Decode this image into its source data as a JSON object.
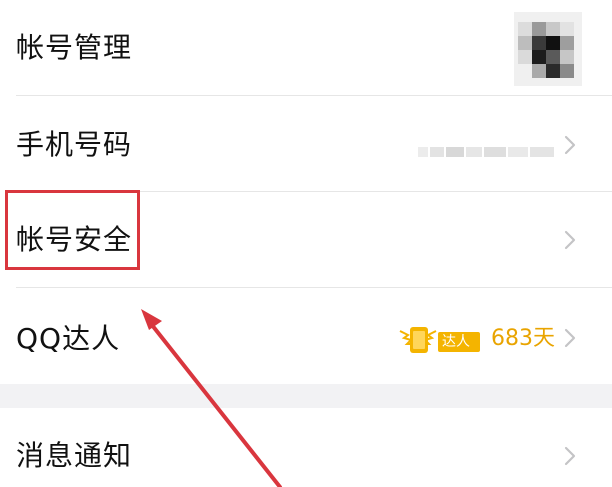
{
  "settings": {
    "items": [
      {
        "label": "帐号管理"
      },
      {
        "label": "手机号码"
      },
      {
        "label": "帐号安全"
      },
      {
        "label": "QQ达人",
        "badge_text": "达人",
        "days": "683天"
      }
    ],
    "notification": {
      "label": "消息通知"
    }
  },
  "colors": {
    "highlight": "#d9363e",
    "accent_gold": "#f4b400",
    "days_text": "#e9a400",
    "chevron": "#c4c4c6"
  },
  "icons": {
    "chevron": "chevron-right-icon",
    "badge": "qq-daren-badge-icon",
    "avatar": "avatar"
  }
}
